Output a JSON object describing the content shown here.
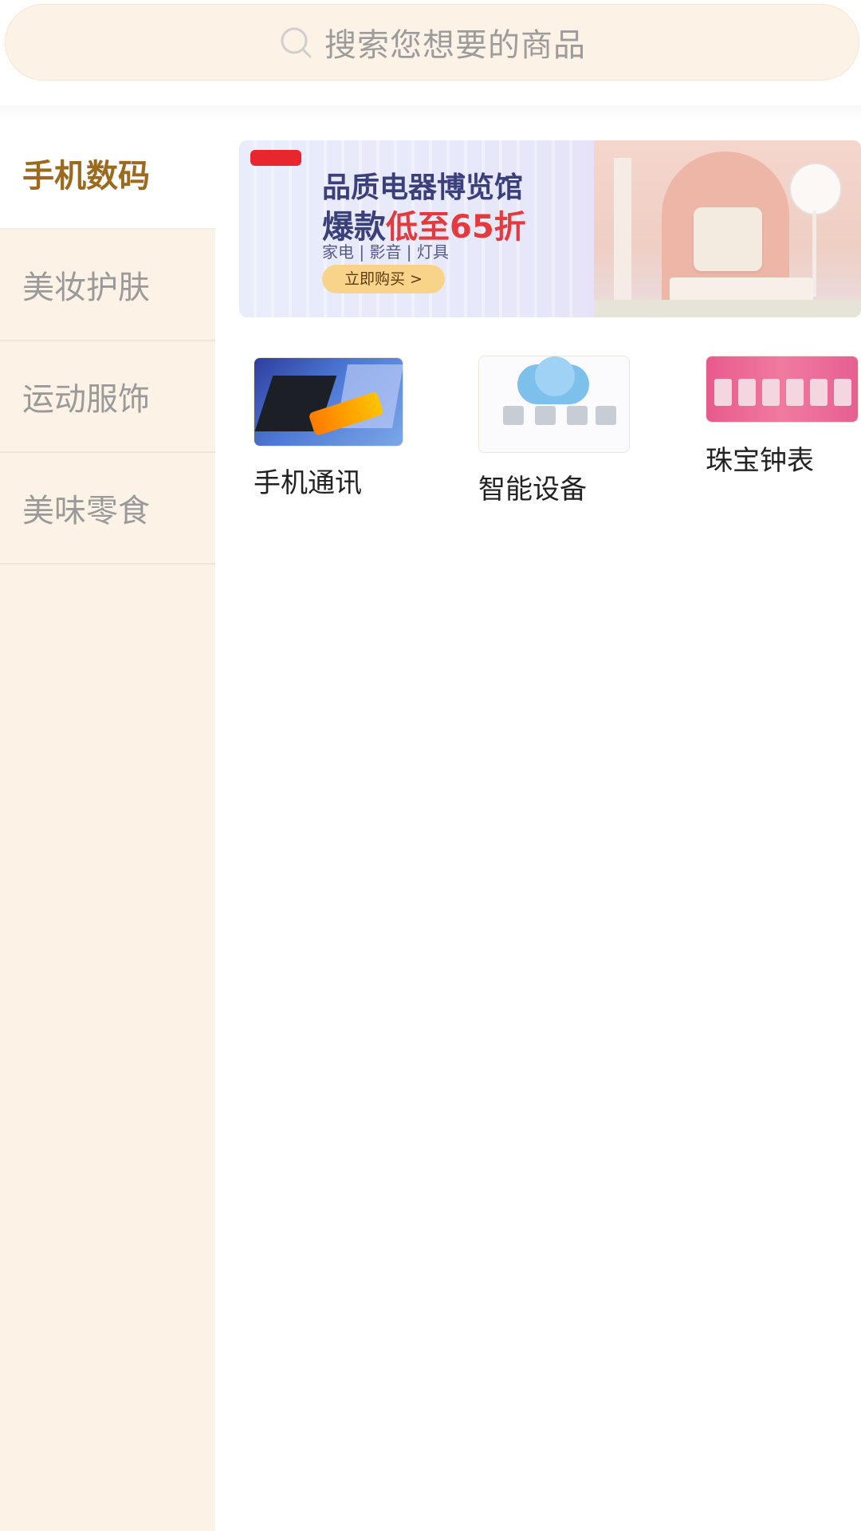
{
  "search": {
    "placeholder": "搜索您想要的商品",
    "icon": "search-icon"
  },
  "sidebar": {
    "items": [
      {
        "label": "手机数码",
        "active": true
      },
      {
        "label": "美妆护肤",
        "active": false
      },
      {
        "label": "运动服饰",
        "active": false
      },
      {
        "label": "美味零食",
        "active": false
      }
    ]
  },
  "banner": {
    "line1": "品质电器博览馆",
    "line2_prefix": "爆款",
    "line2_highlight": "低至65折",
    "categories": "家电 | 影音 | 灯具",
    "button": "立即购买 >"
  },
  "categories": [
    {
      "label": "手机通讯"
    },
    {
      "label": "智能设备"
    },
    {
      "label": "珠宝钟表"
    }
  ],
  "colors": {
    "accent": "#9c6a1f",
    "sidebar_bg": "#fdf2e6",
    "search_bg": "#fdf2e6",
    "highlight_red": "#e53a3d"
  }
}
